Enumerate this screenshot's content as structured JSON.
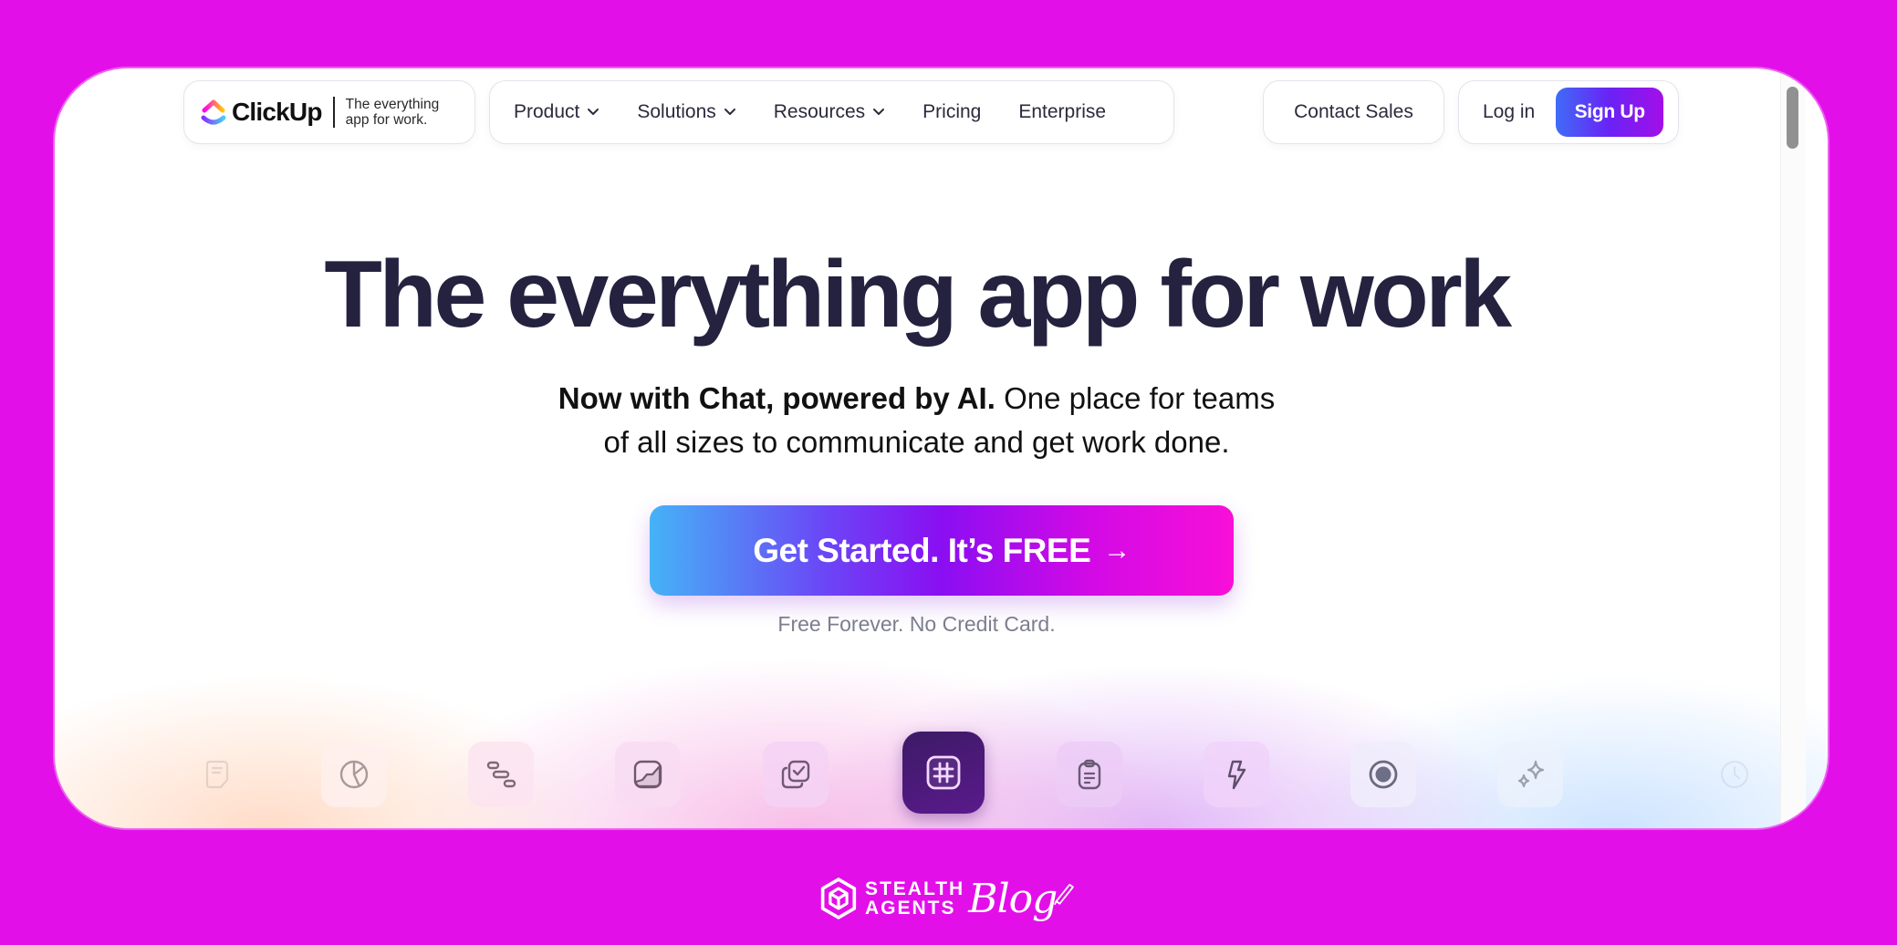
{
  "colors": {
    "frame_background": "#e30fe9",
    "headline": "#24223f",
    "text": "#2a2b3c",
    "muted": "#7c7e8f",
    "signup_gradient": [
      "#3f6cf7",
      "#6a22f5",
      "#a20fe8"
    ],
    "cta_gradient": [
      "#45b3f7",
      "#6b46f6",
      "#8a0ef2",
      "#d10ae6",
      "#f90fd8"
    ],
    "active_tile": "#4a1a78"
  },
  "header": {
    "logo": {
      "name": "ClickUp",
      "tagline_line1": "The everything",
      "tagline_line2": "app for work."
    },
    "nav": [
      {
        "label": "Product",
        "has_dropdown": true
      },
      {
        "label": "Solutions",
        "has_dropdown": true
      },
      {
        "label": "Resources",
        "has_dropdown": true
      },
      {
        "label": "Pricing",
        "has_dropdown": false
      },
      {
        "label": "Enterprise",
        "has_dropdown": false
      }
    ],
    "contact_sales": "Contact Sales",
    "login": "Log in",
    "signup": "Sign Up"
  },
  "hero": {
    "headline": "The everything app for work",
    "subhead_bold": "Now with Chat, powered by AI.",
    "subhead_rest_line1": " One place for teams",
    "subhead_line2": "of all sizes to communicate and get work done.",
    "cta_label": "Get Started. It’s FREE",
    "cta_arrow": "→",
    "cta_note": "Free Forever. No Credit Card."
  },
  "feature_icons": [
    {
      "icon": "document-icon",
      "active": false
    },
    {
      "icon": "pie-chart-icon",
      "active": false
    },
    {
      "icon": "gantt-icon",
      "active": false
    },
    {
      "icon": "dashboard-chart-icon",
      "active": false
    },
    {
      "icon": "tasks-check-icon",
      "active": false
    },
    {
      "icon": "chat-hash-icon",
      "active": true
    },
    {
      "icon": "clipboard-icon",
      "active": false
    },
    {
      "icon": "lightning-icon",
      "active": false
    },
    {
      "icon": "record-icon",
      "active": false
    },
    {
      "icon": "ai-sparkle-icon",
      "active": false
    },
    {
      "icon": "clock-icon",
      "active": false
    }
  ],
  "footer_brand": {
    "line1": "STEALTH",
    "line2": "AGENTS",
    "script": "Blog"
  }
}
